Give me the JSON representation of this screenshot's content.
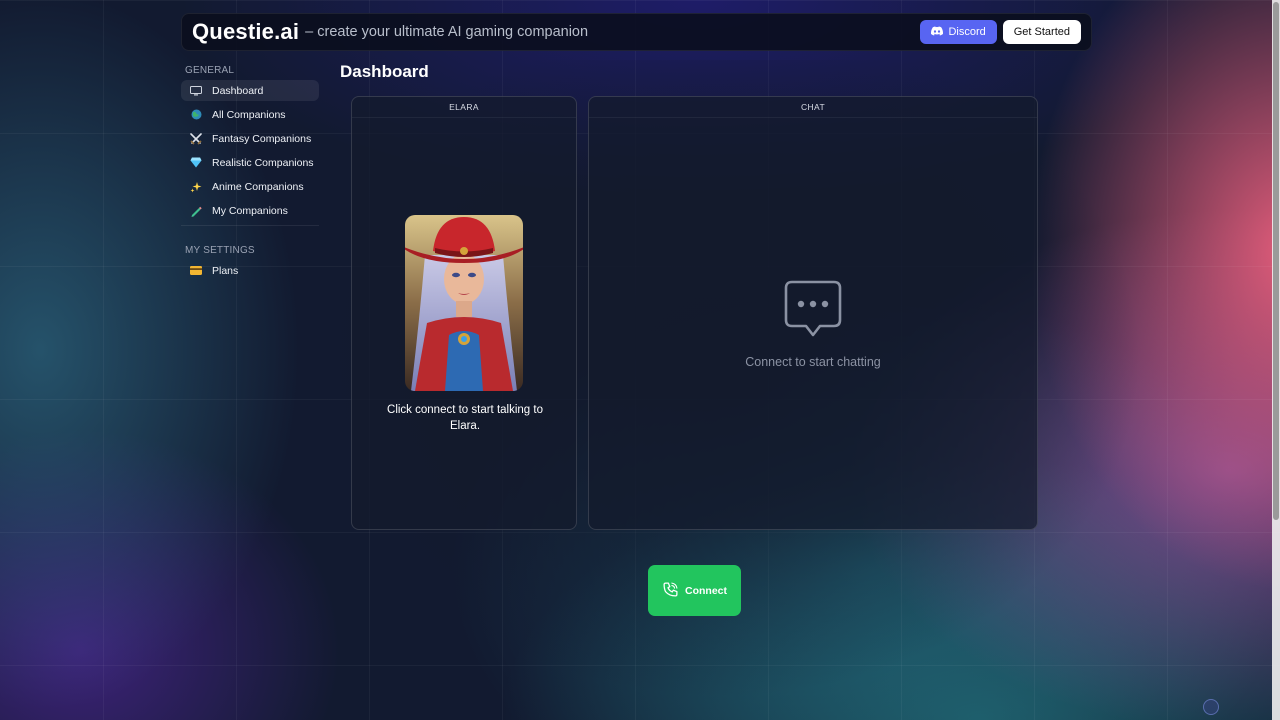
{
  "header": {
    "brand": "Questie.ai",
    "tagline": "– create your ultimate AI gaming companion",
    "discord_label": "Discord",
    "get_started_label": "Get Started"
  },
  "sidebar": {
    "general_title": "GENERAL",
    "items": [
      {
        "label": "Dashboard",
        "icon": "monitor-icon"
      },
      {
        "label": "All Companions",
        "icon": "globe-icon"
      },
      {
        "label": "Fantasy Companions",
        "icon": "crossed-swords-icon"
      },
      {
        "label": "Realistic Companions",
        "icon": "gem-icon"
      },
      {
        "label": "Anime Companions",
        "icon": "sparkles-icon"
      },
      {
        "label": "My Companions",
        "icon": "pencil-icon"
      }
    ],
    "settings_title": "MY SETTINGS",
    "settings_items": [
      {
        "label": "Plans",
        "icon": "credit-card-icon"
      }
    ]
  },
  "main": {
    "page_title": "Dashboard",
    "companion_panel": {
      "header": "ELARA",
      "caption": "Click connect to start talking to Elara."
    },
    "chat_panel": {
      "header": "CHAT",
      "empty_text": "Connect to start chatting"
    },
    "connect_label": "Connect"
  },
  "colors": {
    "accent_discord": "#5865f2",
    "connect_green": "#22c55e",
    "background": "#121a30"
  }
}
